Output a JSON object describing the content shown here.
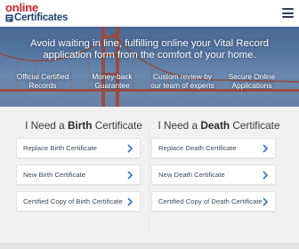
{
  "header": {
    "logo_line1": "online",
    "logo_line2": "Certificates",
    "menu_icon": "hamburger-menu-icon"
  },
  "hero": {
    "title": "Avoid waiting in line, fulfilling online your Vital Record application form from the comfort of your home.",
    "features": [
      "Official Certified Records",
      "Money-back Guarantee",
      "Custom review by our team of experts",
      "Secure Online Applications"
    ]
  },
  "birth": {
    "title_prefix": "I Need a ",
    "title_bold": "Birth",
    "title_suffix": " Certificate",
    "buttons": [
      "Replace Birth Certificate",
      "New Birth Certificate",
      "Certified Copy of Birth Certificate"
    ]
  },
  "death": {
    "title_prefix": "I Need a ",
    "title_bold": "Death",
    "title_suffix": " Certificate",
    "buttons": [
      "Replace Death Certificate",
      "New Death Certificate",
      "Certified Copy of Death Certificate"
    ]
  },
  "colors": {
    "brand_red": "#d42129",
    "brand_navy": "#1c3f72",
    "chevron_blue": "#2f73c9"
  }
}
